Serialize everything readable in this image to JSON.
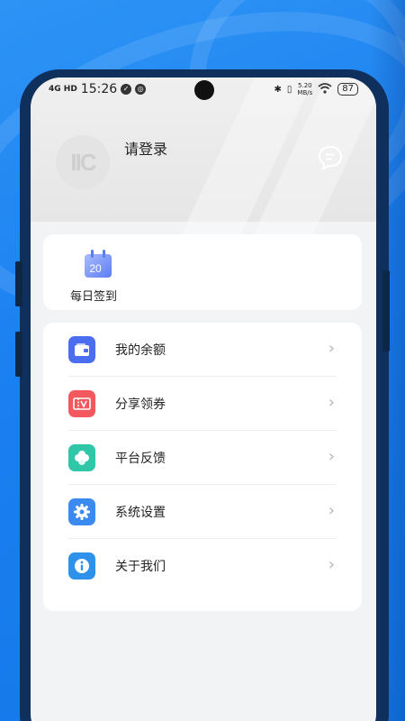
{
  "status_bar": {
    "signal": "4G HD",
    "time": "15:26",
    "speed_value": "5.20",
    "speed_unit": "MB/s",
    "battery": "87"
  },
  "profile": {
    "avatar_letters": "IIC",
    "login_label": "请登录"
  },
  "checkin": {
    "calendar_day": "20",
    "label": "每日签到"
  },
  "menu": [
    {
      "label": "我的余额",
      "icon": "wallet-icon",
      "color": "#4b6ef0"
    },
    {
      "label": "分享领券",
      "icon": "coupon-icon",
      "color": "#f2585e"
    },
    {
      "label": "平台反馈",
      "icon": "clover-icon",
      "color": "#2fc7a8"
    },
    {
      "label": "系统设置",
      "icon": "gear-icon",
      "color": "#3a8af0"
    },
    {
      "label": "关于我们",
      "icon": "info-icon",
      "color": "#2e92ea"
    }
  ],
  "colors": {
    "background": "#1e88f0",
    "phone_frame": "#0f2f5c"
  }
}
